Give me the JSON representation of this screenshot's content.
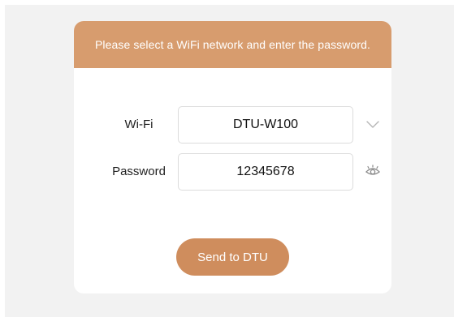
{
  "header": {
    "message": "Please select a WiFi network and enter the password."
  },
  "form": {
    "wifi": {
      "label": "Wi-Fi",
      "value": "DTU-W100",
      "icon": "chevron-down-icon"
    },
    "password": {
      "label": "Password",
      "value": "12345678",
      "icon": "eye-icon"
    }
  },
  "actions": {
    "send_label": "Send to DTU"
  },
  "colors": {
    "header_bg": "#d79c6e",
    "button_bg": "#cf8d5d",
    "page_bg": "#f2f2f2",
    "icon": "#9a9a9a"
  }
}
